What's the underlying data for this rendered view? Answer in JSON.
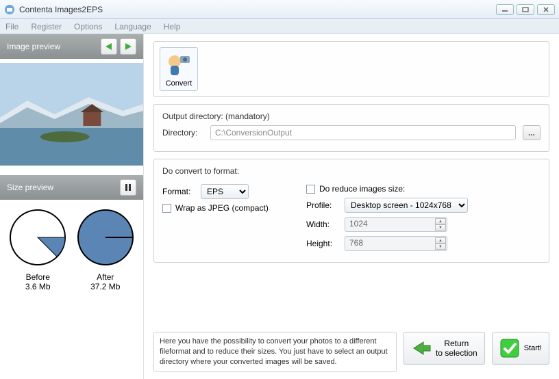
{
  "window": {
    "title": "Contenta Images2EPS"
  },
  "menu": {
    "file": "File",
    "register": "Register",
    "options": "Options",
    "language": "Language",
    "help": "Help"
  },
  "sidebar": {
    "preview_header": "Image preview",
    "size_header": "Size preview",
    "before_label": "Before",
    "before_value": "3.6 Mb",
    "after_label": "After",
    "after_value": "37.2 Mb"
  },
  "convert": {
    "tile_label": "Convert"
  },
  "output": {
    "group_label": "Output directory: (mandatory)",
    "directory_label": "Directory:",
    "directory_value": "C:\\ConversionOutput"
  },
  "format": {
    "group_label": "Do convert to format:",
    "format_label": "Format:",
    "format_value": "EPS",
    "wrap_label": "Wrap as JPEG (compact)",
    "reduce_label": "Do reduce images size:",
    "profile_label": "Profile:",
    "profile_value": "Desktop screen - 1024x768",
    "width_label": "Width:",
    "width_value": "1024",
    "height_label": "Height:",
    "height_value": "768"
  },
  "help_text": "Here you have the possibility to convert your photos to a different fileformat and to reduce their sizes. You just have to select an output directory where your converted images will be saved.",
  "buttons": {
    "return_line1": "Return",
    "return_line2": "to selection",
    "start": "Start!"
  }
}
